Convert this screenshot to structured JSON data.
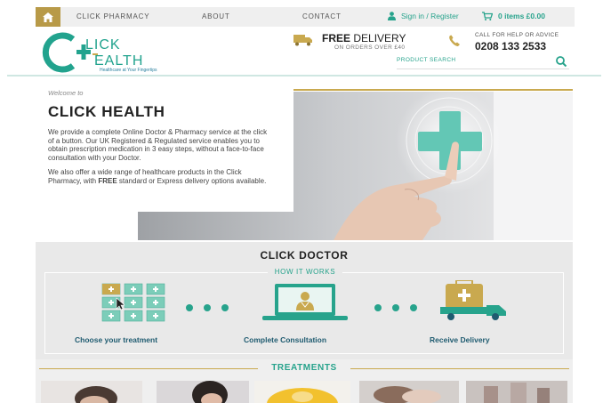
{
  "topnav": {
    "links": [
      "CLICK PHARMACY",
      "ABOUT",
      "CONTACT"
    ],
    "signin": "Sign in / Register",
    "cart": "0 items £0.00"
  },
  "header": {
    "logo_line1": "LICK",
    "logo_line2": "EALTH",
    "logo_tagline": "Healthcare at Your Fingertips",
    "delivery_bold": "FREE",
    "delivery_rest": " DELIVERY",
    "delivery_sub": "ON ORDERS OVER £40",
    "help_title": "CALL FOR HELP OR ADVICE",
    "help_phone": "0208 133 2533",
    "search_placeholder": "PRODUCT SEARCH"
  },
  "hero": {
    "welcome": "Welcome to",
    "title": "CLICK HEALTH",
    "p1": "We provide a complete Online Doctor & Pharmacy service at the click of a button. Our UK Registered & Regulated service enables you to obtain prescription medication in 3 easy steps, without a face-to-face consultation with your Doctor.",
    "p2_a": "We also offer a wide range of healthcare products in the Click Pharmacy, with ",
    "p2_bold": "FREE",
    "p2_b": " standard or Express delivery options available."
  },
  "doctor": {
    "title": "CLICK DOCTOR",
    "how": "HOW IT WORKS",
    "steps": [
      "Choose your treatment",
      "Complete Consultation",
      "Receive Delivery"
    ]
  },
  "treatments": {
    "title": "TREATMENTS"
  },
  "colors": {
    "teal": "#27a38c",
    "gold": "#b89a48",
    "navy": "#1f5b70"
  }
}
